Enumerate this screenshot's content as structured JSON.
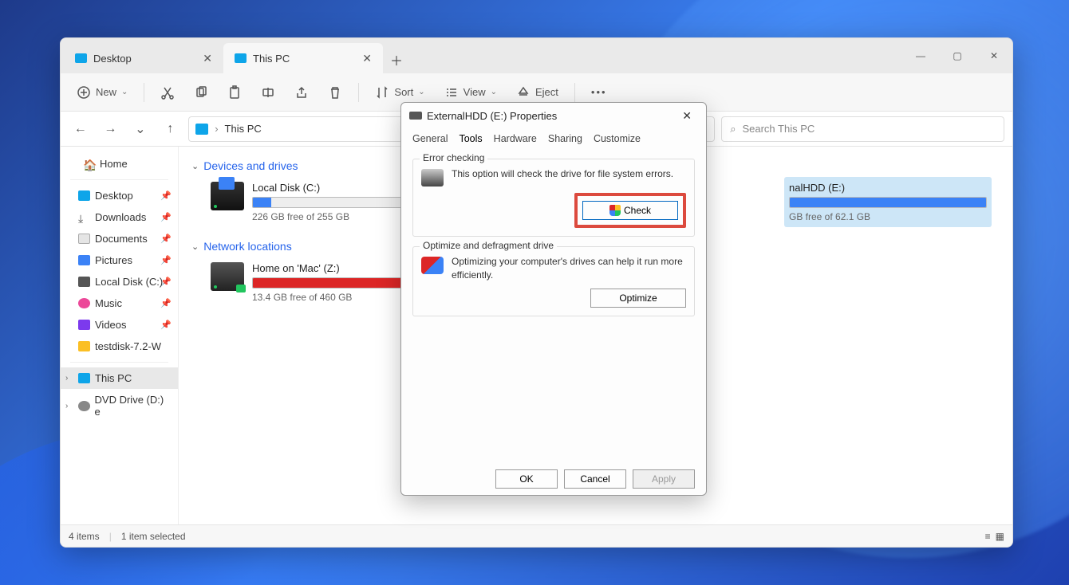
{
  "tabs": {
    "inactive": "Desktop",
    "active": "This PC"
  },
  "toolbar": {
    "new": "New",
    "sort": "Sort",
    "view": "View",
    "eject": "Eject"
  },
  "breadcrumb": {
    "location": "This PC"
  },
  "search": {
    "placeholder": "Search This PC"
  },
  "sidebar": {
    "home": "Home",
    "desktop": "Desktop",
    "downloads": "Downloads",
    "documents": "Documents",
    "pictures": "Pictures",
    "localdisk": "Local Disk (C:)",
    "music": "Music",
    "videos": "Videos",
    "testdisk": "testdisk-7.2-W",
    "thispc": "This PC",
    "dvd": "DVD Drive (D:) e"
  },
  "sections": {
    "devices": "Devices and drives",
    "network": "Network locations"
  },
  "drives": {
    "local": {
      "name": "Local Disk (C:)",
      "free": "226 GB free of 255 GB",
      "fill": 12
    },
    "ext": {
      "name": "ExternalHDD (E:)",
      "free": "GB free of 62.1 GB",
      "fill": 100,
      "name_partial": "nalHDD (E:)"
    },
    "net": {
      "name": "Home on 'Mac' (Z:)",
      "free": "13.4 GB free of 460 GB",
      "fill": 97
    }
  },
  "status": {
    "items": "4 items",
    "selected": "1 item selected"
  },
  "dialog": {
    "title": "ExternalHDD (E:) Properties",
    "tabs": {
      "general": "General",
      "tools": "Tools",
      "hardware": "Hardware",
      "sharing": "Sharing",
      "customize": "Customize"
    },
    "errcheck": {
      "title": "Error checking",
      "text": "This option will check the drive for file system errors.",
      "btn": "Check"
    },
    "defrag": {
      "title": "Optimize and defragment drive",
      "text": "Optimizing your computer's drives can help it run more efficiently.",
      "btn": "Optimize"
    },
    "buttons": {
      "ok": "OK",
      "cancel": "Cancel",
      "apply": "Apply"
    }
  }
}
